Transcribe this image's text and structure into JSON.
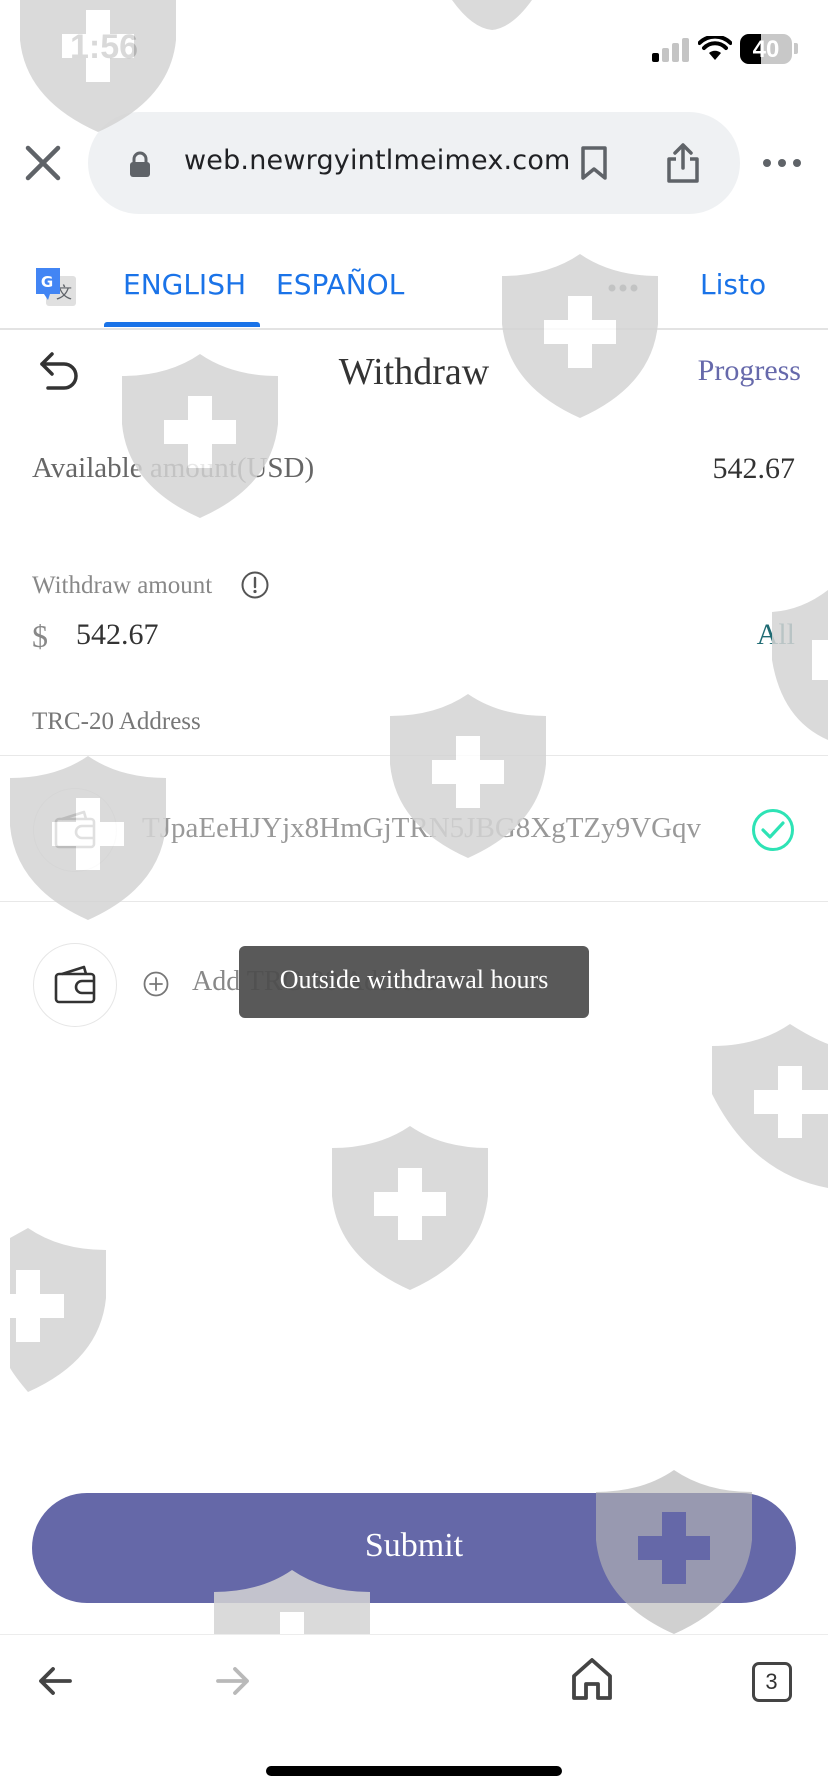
{
  "status_bar": {
    "time": "1:56",
    "battery": "40",
    "battery_level_percent": 40,
    "signal_bars_active": 1,
    "signal_bars_total": 4
  },
  "browser": {
    "url": "web.newrgyintlmeimex.com",
    "icons": [
      "close-icon",
      "lock-icon",
      "bookmark-icon",
      "share-icon",
      "more-icon"
    ]
  },
  "translate": {
    "tabs": [
      {
        "label": "ENGLISH",
        "selected": true
      },
      {
        "label": "ESPAÑOL",
        "selected": false
      }
    ],
    "done_label": "Listo",
    "accent_color": "#1a73e8"
  },
  "page": {
    "title": "Withdraw",
    "progress_label": "Progress",
    "available_label": "Available amount(USD)",
    "available_value": "542.67",
    "withdraw_label": "Withdraw amount",
    "currency_symbol": "$",
    "withdraw_value": "542.67",
    "all_label": "All",
    "address_section_label": "TRC-20 Address",
    "address": "TJpaEeHJYjx8HmGjTRN5JBG8XgTZy9VGqv",
    "add_address_label": "Add TRC-20 Address",
    "toast": "Outside withdrawal hours",
    "submit_label": "Submit",
    "button_color": "#6568a8",
    "check_color": "#2ee3b5"
  },
  "toolbar": {
    "tab_count": "3",
    "icons": [
      "back-arrow-icon",
      "forward-arrow-icon",
      "home-icon",
      "tabs-icon"
    ]
  }
}
